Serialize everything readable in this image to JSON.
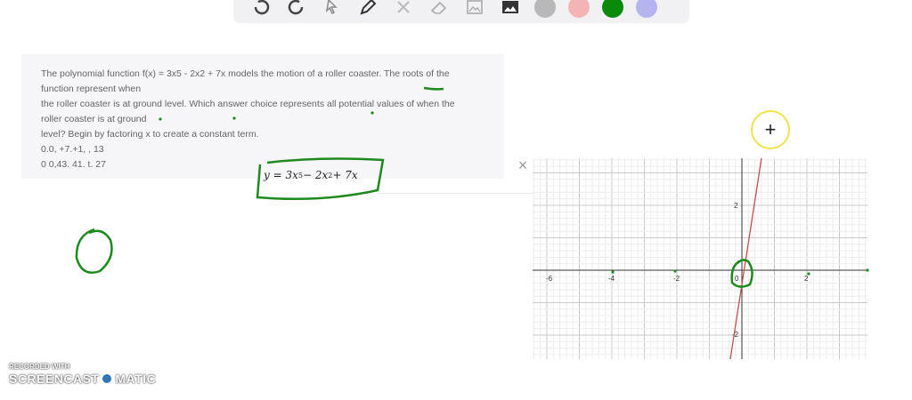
{
  "question": {
    "lines": [
      "The polynomial function f(x) = 3x5 - 2x2 + 7x models the motion of a roller coaster. The roots of the",
      "function represent when",
      "the roller coaster is at ground level. Which answer choice represents all potential values of when the",
      "roller coaster is at ground",
      "level? Begin by factoring x to create a constant term.",
      "0.0, +7.+1, , 13",
      "0 0,43. 41. t. 27"
    ]
  },
  "expression": {
    "lhs": "y = 3x",
    "exp1": "5",
    "mid": " − 2x",
    "exp2": "2",
    "rhs": " + 7x"
  },
  "close_label": "×",
  "add_label": "+",
  "graph": {
    "x_ticks": [
      "-6",
      "-4",
      "-2",
      "0",
      "2"
    ],
    "y_ticks": [
      "2",
      "-2"
    ],
    "curve_color": "#c0504d"
  },
  "colors": {
    "ink_green": "#1e8a1e",
    "toolbar_bg": "#f1f1f3",
    "swatch_gray": "#b8b8b8",
    "swatch_pink": "#f4b3b5",
    "swatch_green": "#0a8a0a",
    "swatch_lavender": "#b4b4ee"
  },
  "watermark": {
    "line1": "RECORDED WITH",
    "brand_left": "SCREENCAST",
    "brand_right": "MATIC"
  }
}
